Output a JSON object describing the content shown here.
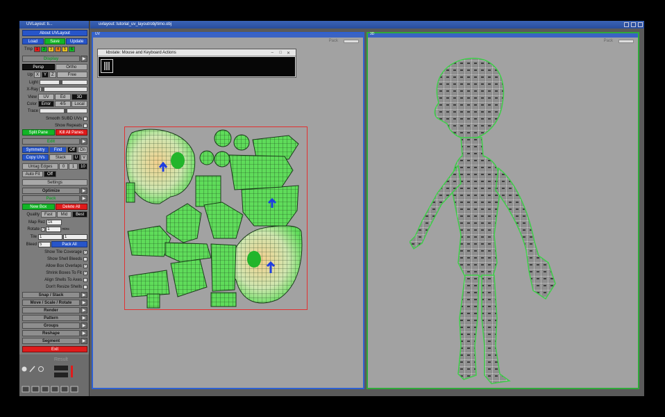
{
  "panel": {
    "title": "UVLayout: ti...",
    "about": "About UVLayout",
    "file": {
      "load": "Load",
      "save": "Save",
      "update": "Update"
    },
    "tmp": {
      "label": "Tmp",
      "slots": [
        "1",
        "2",
        "3",
        "4",
        "5",
        "6"
      ],
      "slot_colors": [
        "#e01b1b",
        "#12b526",
        "#e8c020",
        "#e07b1b",
        "#e8c020",
        "#12b526"
      ]
    },
    "section_display": "Display",
    "view": {
      "persp": "Persp",
      "ortho": "Ortho"
    },
    "up": {
      "label": "Up",
      "x": "X",
      "y": "Y",
      "z": "Z",
      "free": "Free"
    },
    "light": "Light",
    "xray": "X-Ray",
    "view_mode": {
      "label": "View",
      "uv": "UV",
      "ed": "Ed",
      "threed": "3D"
    },
    "color": {
      "label": "Color",
      "error": "Error",
      "ratio": "4/5",
      "local": "Local"
    },
    "trace": "Trace",
    "smooth": "Smooth SUBD UVs",
    "show_repeats": "Show Repeats",
    "split_pane": "Split Pane",
    "kill_panes": "Kill All Panes",
    "section_edit": "Edit",
    "symmetry": {
      "label": "Symmetry",
      "find": "Find",
      "off": "Off",
      "on": "On"
    },
    "copy": {
      "label": "Copy UVs",
      "stack": "Stack",
      "u": "U",
      "v": "V"
    },
    "untag": {
      "label": "Untag Edges",
      "a": "0",
      "b": "1",
      "c": "10"
    },
    "autofit": {
      "label": "Auto Fit",
      "off": "Off"
    },
    "settings": "Settings",
    "optimize": "Optimize",
    "section_pack": "Pack",
    "new_box": "New Box",
    "delete_all": "Delete All",
    "quality": {
      "label": "Quality",
      "fast": "Fast",
      "mid": "Mid",
      "best": "Best"
    },
    "map_rez": {
      "label": "Map Rez",
      "value": "1k"
    },
    "rotate": {
      "label": "Rotate",
      "value": "1",
      "unit": "mins"
    },
    "tile": {
      "label": "Tile",
      "a": "1",
      "b": "1"
    },
    "bleed": {
      "label": "Bleed",
      "value": "5",
      "pack_all": "Pack All"
    },
    "options": [
      "Show Tile Coverage",
      "Show Shell Bleeds",
      "Allow Box Overlaps",
      "Shrink Boxes To Fit",
      "Align Shells To Axes",
      "Don't Resize Shells"
    ],
    "sections": [
      "Snap / Stack",
      "Move / Scale / Rotate",
      "Render",
      "Pattern",
      "Groups",
      "Reshape",
      "Segment"
    ],
    "exit": "Exit",
    "bottom_label": "Result"
  },
  "topbar": {
    "title": "uvlayout: tutorial_uv_layout/obj/timo.obj"
  },
  "uv_view": {
    "tab": "UV",
    "pack_label": "Pack"
  },
  "model_view": {
    "tab": "3D",
    "pack_label": "Pack"
  },
  "kbstate": {
    "title": "kbstate: Mouse and Keyboard Actions"
  },
  "colors": {
    "accent": "#2e61d3",
    "shell": "#3fd04a",
    "pack_green": "#12b526",
    "danger": "#e01b1b"
  }
}
